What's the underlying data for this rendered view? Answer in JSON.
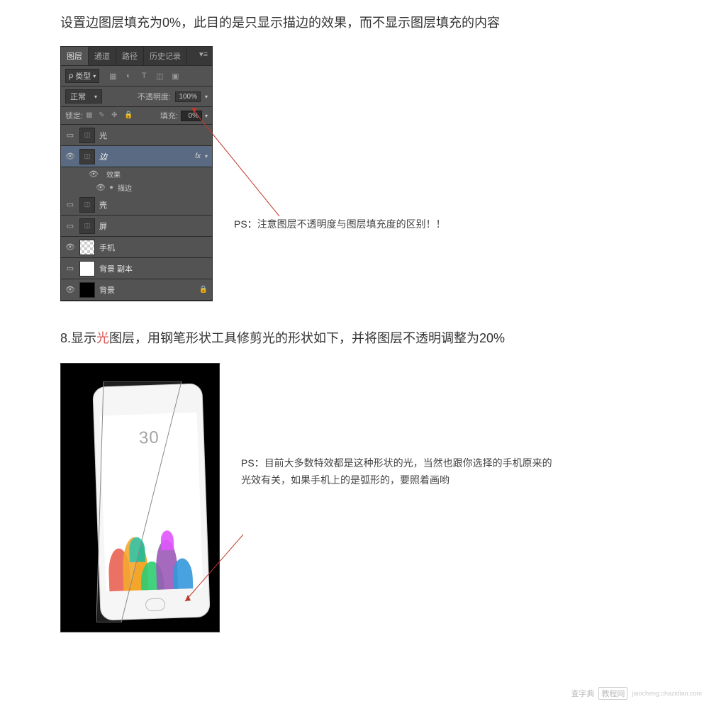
{
  "intro": "设置边图层填充为0%，此目的是只显示描边的效果，而不显示图层填充的内容",
  "psPanel": {
    "tabs": {
      "layers": "图层",
      "channels": "通道",
      "paths": "路径",
      "history": "历史记录"
    },
    "filter": {
      "label": "类型"
    },
    "blend": {
      "mode": "正常",
      "opacityLabel": "不透明度:",
      "opacityValue": "100%"
    },
    "lock": {
      "label": "锁定:",
      "fillLabel": "填充:",
      "fillValue": "0%"
    },
    "layers": {
      "light": "光",
      "edge": "边",
      "fx": "fx",
      "effects": "效果",
      "stroke": "描边",
      "shell": "壳",
      "screen": "屏",
      "phone": "手机",
      "bgcopy": "背景 副本",
      "bg": "背景"
    }
  },
  "annotation1": {
    "prefix": "PS：",
    "text": "注意图层不透明度与图层填充度的区别！！"
  },
  "step8": {
    "num": "8.",
    "pre": "显示",
    "hl": "光",
    "post": "图层，用钢笔形状工具修剪光的形状如下，并将图层不透明调整为20%"
  },
  "phoneTime": "30",
  "annotation2": {
    "prefix": "PS：",
    "line1": "目前大多数特效都是这种形状的光，当然也跟你选择的手机原来的",
    "line2": "光效有关，如果手机上的是弧形的，要照着画哟"
  },
  "watermark": {
    "brand": "查字典",
    "box": "教程网",
    "url": "jiaocheng.chazidian.com"
  }
}
